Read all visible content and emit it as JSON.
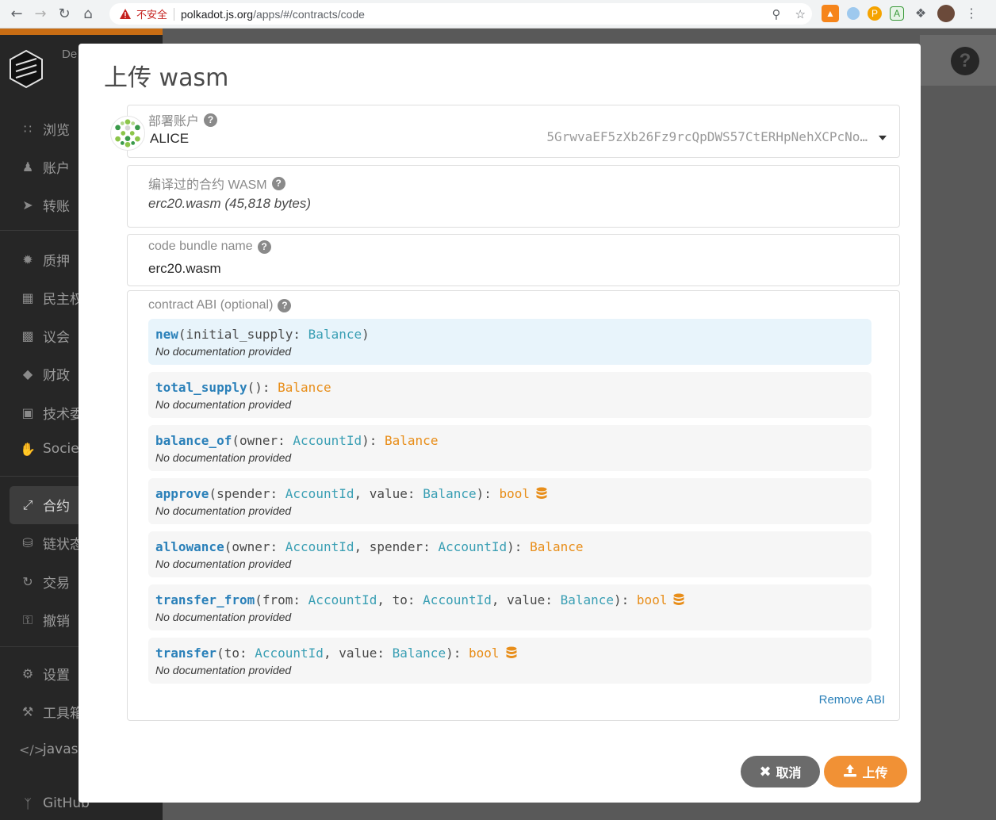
{
  "browser": {
    "insecure_label": "不安全",
    "url_host": "polkadot.js.org",
    "url_rest": "/apps/#/contracts/code"
  },
  "sidebar": {
    "logo_text": "De",
    "items": [
      {
        "label": "浏览",
        "icon": "grid-icon"
      },
      {
        "label": "账户",
        "icon": "users-icon"
      },
      {
        "label": "转账",
        "icon": "paper-plane-icon"
      },
      {
        "label": "质押",
        "icon": "certificate-icon"
      },
      {
        "label": "民主权",
        "icon": "calendar-icon"
      },
      {
        "label": "议会",
        "icon": "building-icon"
      },
      {
        "label": "财政",
        "icon": "gem-icon"
      },
      {
        "label": "技术委",
        "icon": "microchip-icon"
      },
      {
        "label": "Societ",
        "icon": "hand-icon"
      },
      {
        "label": "合约",
        "icon": "compress-icon"
      },
      {
        "label": "链状态",
        "icon": "database-icon"
      },
      {
        "label": "交易",
        "icon": "sync-icon"
      },
      {
        "label": "撤销",
        "icon": "unlock-icon"
      },
      {
        "label": "设置",
        "icon": "cogs-icon"
      },
      {
        "label": "工具箱",
        "icon": "tools-icon"
      },
      {
        "label": "javasc",
        "icon": "code-icon"
      },
      {
        "label": "GitHub",
        "icon": "code-branch-icon"
      }
    ]
  },
  "modal": {
    "title": "上传 wasm",
    "account": {
      "label": "部署账户",
      "name": "ALICE",
      "address": "5GrwvaEF5zXb26Fz9rcQpDWS57CtERHpNehXCPcNo…"
    },
    "wasm": {
      "label": "编译过的合约 WASM",
      "value": "erc20.wasm (45,818 bytes)"
    },
    "bundle": {
      "label": "code bundle name",
      "value": "erc20.wasm"
    },
    "abi": {
      "label": "contract ABI (optional)",
      "doc": "No documentation provided",
      "remove_label": "Remove ABI",
      "messages": [
        {
          "name": "new",
          "args": [
            [
              "initial_supply",
              "Balance"
            ]
          ],
          "returns": "",
          "mutates": false
        },
        {
          "name": "total_supply",
          "args": [],
          "returns": "Balance",
          "mutates": false
        },
        {
          "name": "balance_of",
          "args": [
            [
              "owner",
              "AccountId"
            ]
          ],
          "returns": "Balance",
          "mutates": false
        },
        {
          "name": "approve",
          "args": [
            [
              "spender",
              "AccountId"
            ],
            [
              "value",
              "Balance"
            ]
          ],
          "returns": "bool",
          "mutates": true
        },
        {
          "name": "allowance",
          "args": [
            [
              "owner",
              "AccountId"
            ],
            [
              "spender",
              "AccountId"
            ]
          ],
          "returns": "Balance",
          "mutates": false
        },
        {
          "name": "transfer_from",
          "args": [
            [
              "from",
              "AccountId"
            ],
            [
              "to",
              "AccountId"
            ],
            [
              "value",
              "Balance"
            ]
          ],
          "returns": "bool",
          "mutates": true
        },
        {
          "name": "transfer",
          "args": [
            [
              "to",
              "AccountId"
            ],
            [
              "value",
              "Balance"
            ]
          ],
          "returns": "bool",
          "mutates": true
        }
      ]
    },
    "buttons": {
      "cancel": "取消",
      "upload": "上传"
    }
  },
  "colors": {
    "accent": "#f19135",
    "fn_name": "#2a80b9",
    "type": "#3a9fb4",
    "return": "#e88e1a"
  }
}
